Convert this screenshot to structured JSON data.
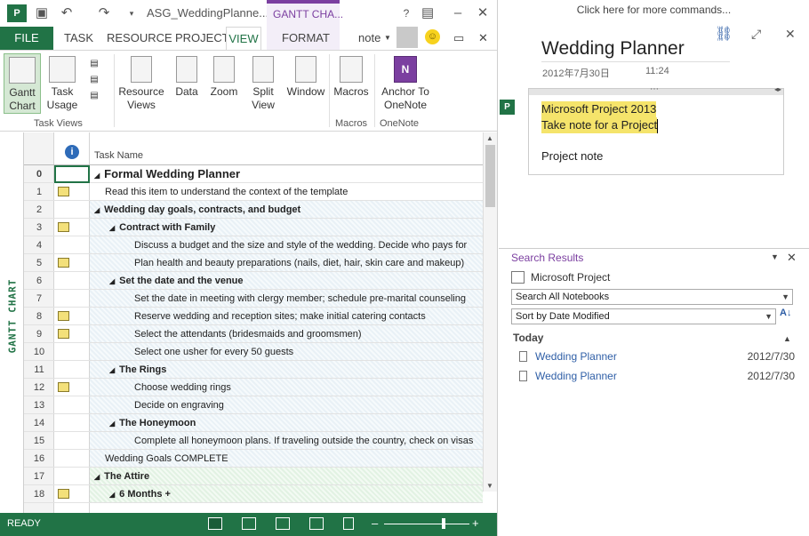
{
  "qat": {
    "doc_title": "ASG_WeddingPlanne...",
    "context_tab": "GANTT CHA...",
    "help": "?",
    "user": "note"
  },
  "tabs": [
    "FILE",
    "TASK",
    "RESOURCE",
    "PROJECT",
    "VIEW",
    "FORMAT"
  ],
  "ribbon": {
    "gantt_chart": "Gantt Chart",
    "task_usage": "Task Usage",
    "resource_views": "Resource Views",
    "data": "Data",
    "zoom": "Zoom",
    "split_view": "Split View",
    "window": "Window",
    "macros": "Macros",
    "anchor": "Anchor To OneNote",
    "group_task_views": "Task Views",
    "group_macros": "Macros",
    "group_onenote": "OneNote"
  },
  "sheet": {
    "header_task": "Task Name",
    "side_label": "GANTT CHART",
    "rows": [
      {
        "n": "0",
        "name": "Formal Wedding Planner",
        "level": 0,
        "note": false
      },
      {
        "n": "1",
        "name": "Read this item to understand the context of the template",
        "level": 1,
        "note": true
      },
      {
        "n": "2",
        "name": "Wedding day goals, contracts, and budget",
        "level": 1,
        "note": false
      },
      {
        "n": "3",
        "name": "Contract with Family",
        "level": 2,
        "note": true
      },
      {
        "n": "4",
        "name": "Discuss a budget and the size and style of the wedding. Decide who pays for",
        "level": 3,
        "note": false
      },
      {
        "n": "5",
        "name": "Plan health and beauty preparations (nails, diet, hair, skin care and makeup)",
        "level": 3,
        "note": true
      },
      {
        "n": "6",
        "name": "Set the date and the venue",
        "level": 2,
        "note": false
      },
      {
        "n": "7",
        "name": "Set the date in meeting with clergy member; schedule pre-marital counseling",
        "level": 3,
        "note": false
      },
      {
        "n": "8",
        "name": "Reserve wedding and reception sites; make initial catering contacts",
        "level": 3,
        "note": true
      },
      {
        "n": "9",
        "name": "Select the attendants (bridesmaids and groomsmen)",
        "level": 3,
        "note": true
      },
      {
        "n": "10",
        "name": "Select one usher for every 50 guests",
        "level": 3,
        "note": false
      },
      {
        "n": "11",
        "name": "The Rings",
        "level": 2,
        "note": false
      },
      {
        "n": "12",
        "name": "Choose wedding rings",
        "level": 3,
        "note": true
      },
      {
        "n": "13",
        "name": "Decide on engraving",
        "level": 3,
        "note": false
      },
      {
        "n": "14",
        "name": "The Honeymoon",
        "level": 2,
        "note": false
      },
      {
        "n": "15",
        "name": "Complete all honeymoon plans. If traveling outside the country, check on visas",
        "level": 3,
        "note": false
      },
      {
        "n": "16",
        "name": "Wedding Goals COMPLETE",
        "level": 1,
        "note": false
      },
      {
        "n": "17",
        "name": "The Attire",
        "level": 1,
        "note": false
      },
      {
        "n": "18",
        "name": "6 Months +",
        "level": 2,
        "note": true
      }
    ]
  },
  "status": {
    "text": "READY"
  },
  "onenote": {
    "more_commands": "Click here for more commands...",
    "page_title": "Wedding Planner",
    "date": "2012年7月30日",
    "time": "11:24",
    "line1": "Microsoft Project 2013",
    "line2": "Take note for a Project",
    "line3": "Project note"
  },
  "search": {
    "title": "Search Results",
    "query": "Microsoft Project",
    "scope": "Search All Notebooks",
    "sort": "Sort by Date Modified",
    "group": "Today",
    "results": [
      {
        "name": "Wedding Planner",
        "date": "2012/7/30"
      },
      {
        "name": "Wedding Planner",
        "date": "2012/7/30"
      }
    ]
  }
}
